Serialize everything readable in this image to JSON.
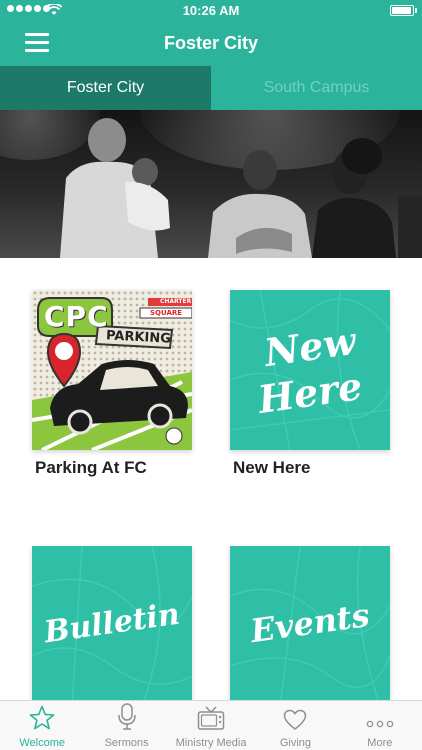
{
  "status_bar": {
    "time": "10:26 AM",
    "signal_bars": 5,
    "battery_level": 0.95
  },
  "nav": {
    "title": "Foster City",
    "menu_icon": "hamburger-menu-icon"
  },
  "campus_tabs": [
    {
      "label": "Foster City",
      "selected": true
    },
    {
      "label": "South Campus",
      "selected": false
    }
  ],
  "hero_image": "church-members-photo",
  "tiles": [
    {
      "label": "Parking At FC",
      "art": "cpc-parking-illustration",
      "art_text": [
        "CPC",
        "PARKING",
        "CHARTER",
        "SQUARE"
      ]
    },
    {
      "label": "New Here",
      "art": "script-text-on-map",
      "art_text": [
        "New",
        "Here"
      ]
    },
    {
      "label": "",
      "art": "script-text-on-map",
      "art_text": [
        "Bulletin"
      ]
    },
    {
      "label": "",
      "art": "script-text-on-map",
      "art_text": [
        "Events"
      ]
    }
  ],
  "tab_bar": [
    {
      "label": "Welcome",
      "icon": "star-icon",
      "active": true
    },
    {
      "label": "Sermons",
      "icon": "microphone-icon",
      "active": false
    },
    {
      "label": "Ministry Media",
      "icon": "tv-icon",
      "active": false
    },
    {
      "label": "Giving",
      "icon": "heart-icon",
      "active": false
    },
    {
      "label": "More",
      "icon": "more-dots-icon",
      "active": false
    }
  ],
  "colors": {
    "primary": "#2bb39c",
    "primary_dark": "#1d7a69",
    "tile_teal": "#2fbfa6",
    "inactive_text": "#6fd2c0"
  }
}
